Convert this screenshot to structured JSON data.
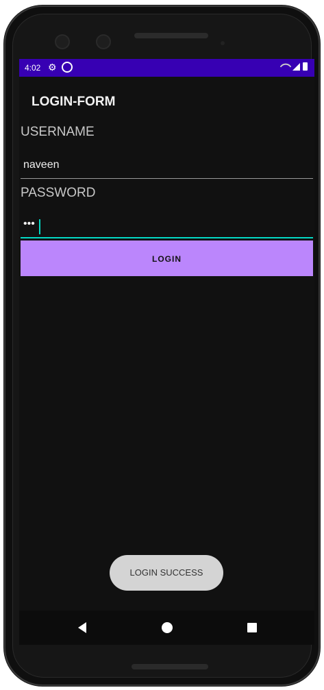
{
  "status_bar": {
    "time": "4:02",
    "gear_icon": "settings-icon",
    "sync_icon": "sync-icon"
  },
  "form": {
    "title": "LOGIN-FORM",
    "username_label": "USERNAME",
    "username_value": "naveen",
    "password_label": "PASSWORD",
    "password_value": "•••",
    "login_button": "LOGIN"
  },
  "toast": {
    "message": "LOGIN SUCCESS"
  },
  "colors": {
    "status_bar": "#3700b3",
    "button": "#bb86fc",
    "accent": "#03dac5",
    "background": "#111111"
  }
}
